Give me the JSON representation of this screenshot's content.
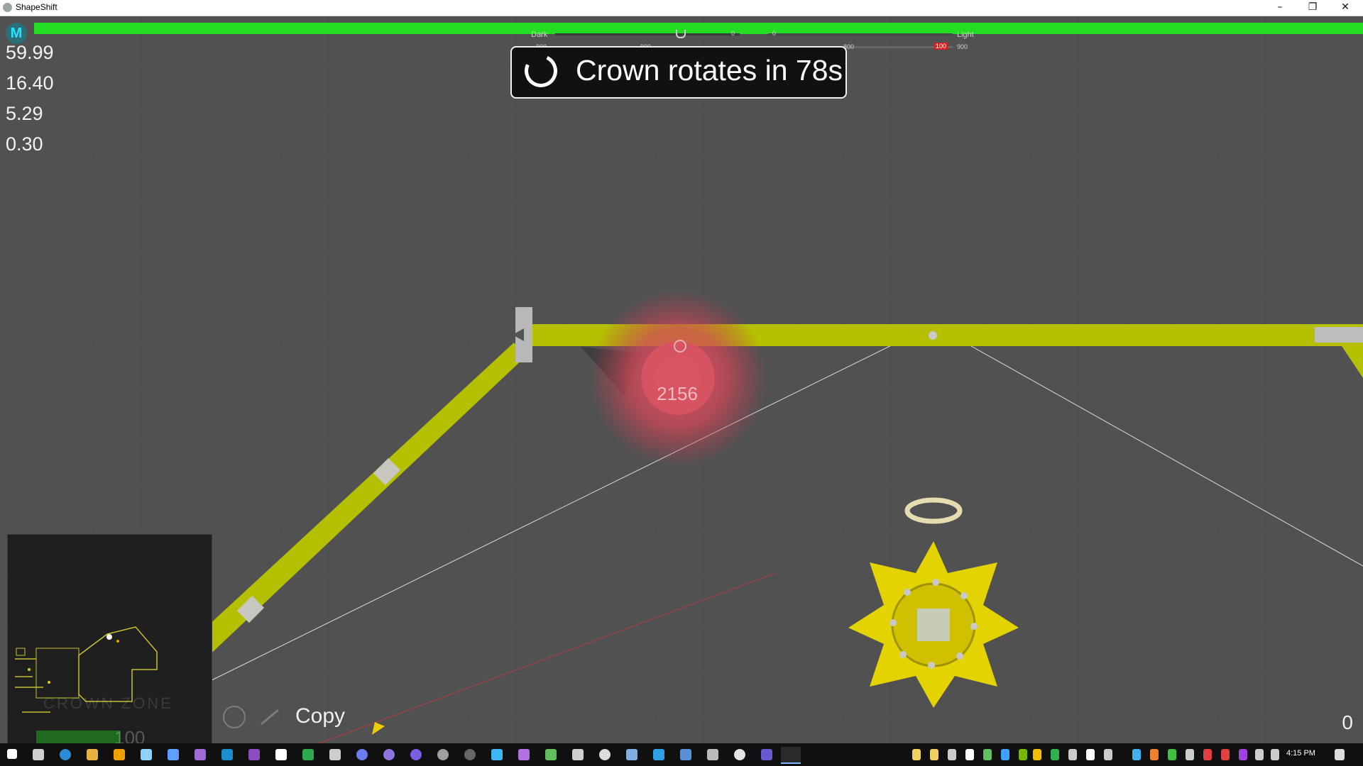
{
  "window": {
    "title": "ShapeShift",
    "minimize": "–",
    "restore": "❐",
    "close": "✕"
  },
  "hud": {
    "avatar_letter": "M",
    "stats": [
      "59.99",
      "16.40",
      "5.29",
      "0.30"
    ],
    "meter": {
      "dark_label": "Dark",
      "light_label": "Light",
      "dark_left": "900",
      "dark_mid": "900",
      "dark_zero": "0",
      "light_zero": "0",
      "light_mid": "800",
      "light_warn": "100",
      "light_right": "900"
    },
    "crown_banner": "Crown rotates in 78s",
    "enemy_hp": "2156",
    "ability_label": "Copy",
    "score": "0"
  },
  "minimap": {
    "zone_label": "CROWN ZONE",
    "hp_value": "100"
  },
  "taskbar": {
    "clock": "4:15 PM"
  },
  "colors": {
    "health": "#22dd22",
    "wall": "#b7c400",
    "player": "#e3d300",
    "enemy": "#d85462",
    "background": "#515151"
  }
}
